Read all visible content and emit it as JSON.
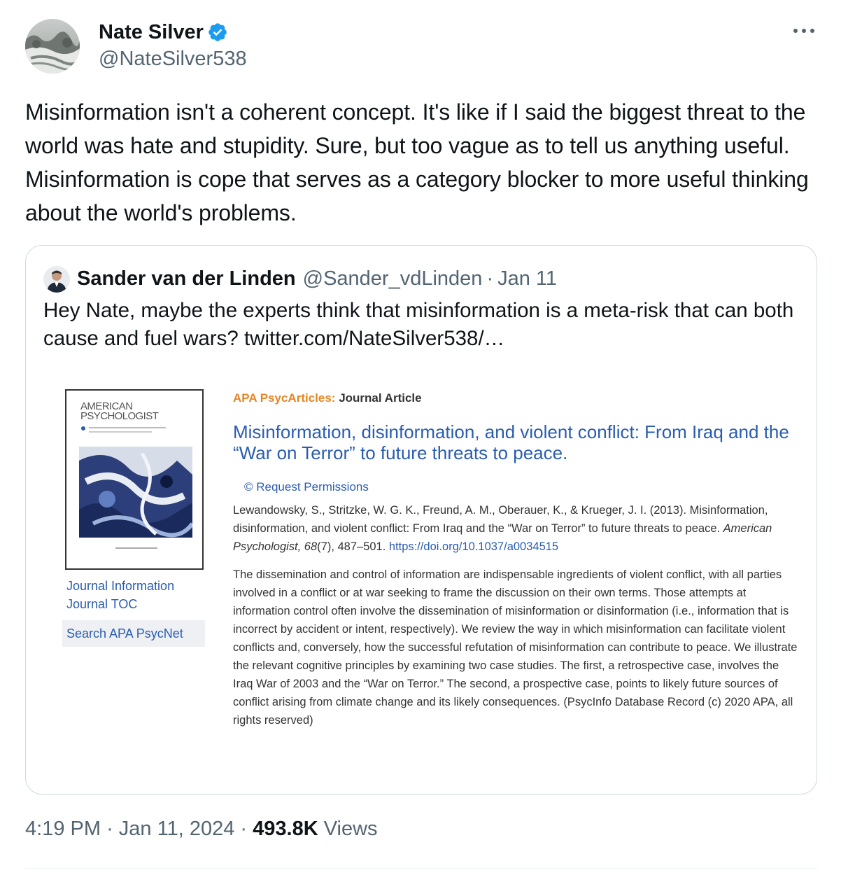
{
  "tweet": {
    "author_name": "Nate Silver",
    "author_handle": "@NateSilver538",
    "text": "Misinformation isn't a coherent concept. It's like if I said the biggest threat to the world was hate and stupidity. Sure, but too vague as to tell us anything useful. Misinformation is cope that serves as a category blocker to more useful thinking about the world's problems.",
    "time": "4:19 PM",
    "date": "Jan 11, 2024",
    "views_count": "493.8K",
    "views_label": "Views",
    "separator": "·",
    "icons": {
      "verified": "verified-badge-icon",
      "more": "more-options-icon"
    },
    "colors": {
      "verified": "#1d9bf0",
      "secondary_text": "#536471"
    }
  },
  "quote": {
    "author_name": "Sander van der Linden",
    "author_handle": "@Sander_vdLinden",
    "separator": "·",
    "date": "Jan 11",
    "text": "Hey Nate, maybe the experts think that misinformation is a meta-risk that can both cause and fuel wars?  twitter.com/NateSilver538/…"
  },
  "article": {
    "cover_title_line1": "AMERICAN",
    "cover_title_line2": "PSYCHOLOGIST",
    "source": "APA PsycArticles:",
    "type": "Journal Article",
    "title": "Misinformation, disinformation, and violent conflict: From Iraq and the “War on Terror” to future threats to peace.",
    "permissions": "© Request Permissions",
    "citation_text": "Lewandowsky, S., Stritzke, W. G. K., Freund, A. M., Oberauer, K., & Krueger, J. I. (2013). Misinformation, disinformation, and violent conflict: From Iraq and the “War on Terror” to future threats to peace.",
    "citation_journal": "American Psychologist, 68",
    "citation_issue": "(7), 487–501.",
    "doi": "https://doi.org/10.1037/a0034515",
    "abstract": "The dissemination and control of information are indispensable ingredients of violent conflict, with all parties involved in a conflict or at war seeking to frame the discussion on their own terms. Those attempts at information control often involve the dissemination of misinformation or disinformation (i.e., information that is incorrect by accident or intent, respectively). We review the way in which misinformation can facilitate violent conflicts and, conversely, how the successful refutation of misinformation can contribute to peace. We illustrate the relevant cognitive principles by examining two case studies. The first, a retrospective case, involves the Iraq War of 2003 and the “War on Terror.” The second, a prospective case, points to likely future sources of conflict arising from climate change and its likely consequences. (PsycInfo Database Record (c) 2020 APA, all rights reserved)",
    "side_links": [
      "Journal Information",
      "Journal TOC"
    ],
    "search_label": "Search APA PsycNet",
    "colors": {
      "link": "#2a5db0",
      "source": "#e38624"
    }
  }
}
